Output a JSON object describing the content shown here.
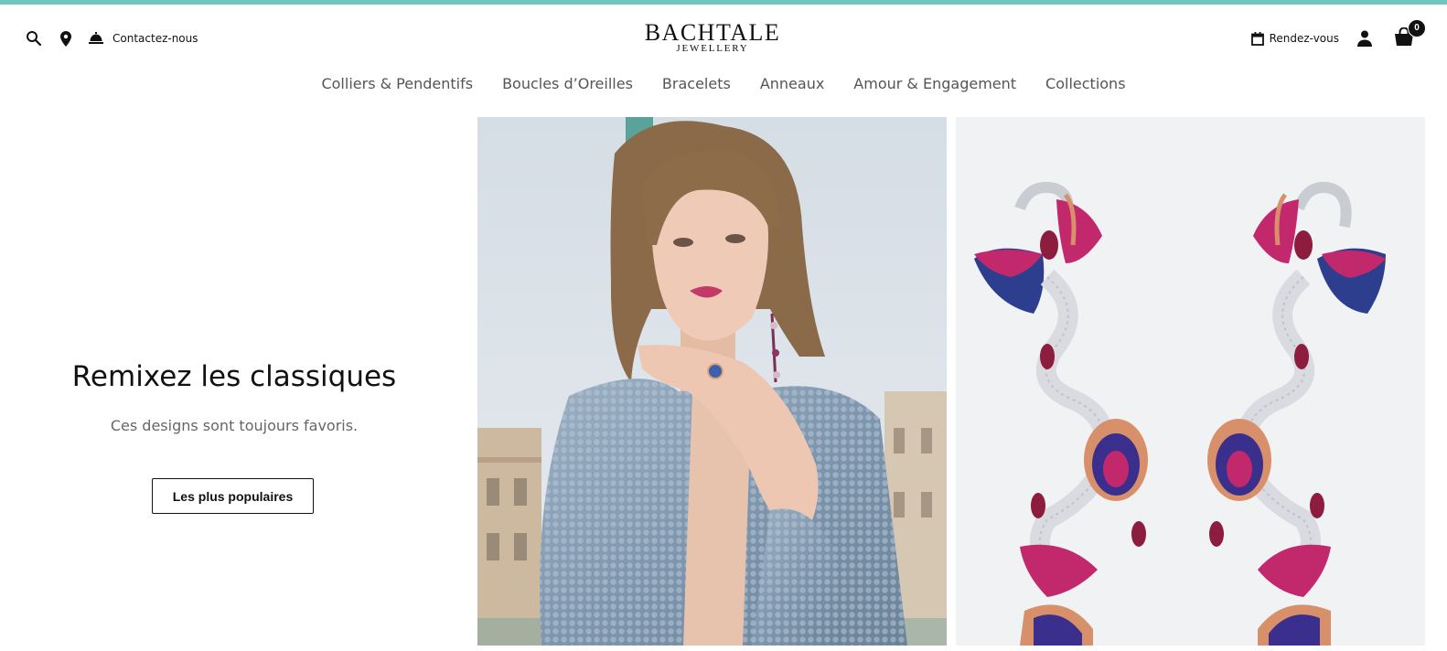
{
  "header": {
    "contact_label": "Contactez-nous",
    "logo": {
      "main": "BACHTALE",
      "sub": "JEWELLERY"
    },
    "appointment_label": "Rendez-vous",
    "cart_count": "0",
    "icons": [
      "search-icon",
      "location-pin-icon",
      "service-bell-icon",
      "calendar-icon",
      "user-icon",
      "shopping-bag-icon"
    ]
  },
  "nav": {
    "items": [
      "Colliers & Pendentifs",
      "Boucles d’Oreilles",
      "Bracelets",
      "Anneaux",
      "Amour & Engagement",
      "Collections"
    ]
  },
  "hero": {
    "headline": "Remixez les classiques",
    "subtitle": "Ces designs sont toujours favoris.",
    "cta_label": "Les plus populaires"
  },
  "colors": {
    "accent_bar": "#6fc7bf",
    "text": "#111111",
    "nav_text": "#555555"
  }
}
